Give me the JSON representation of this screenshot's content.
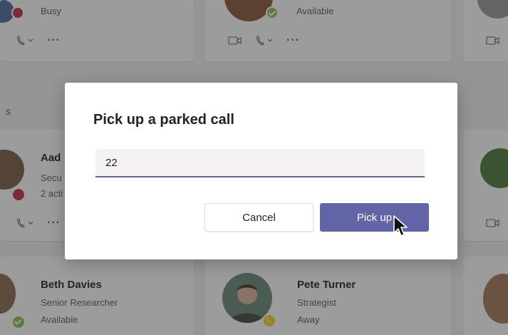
{
  "contacts": {
    "top_left": {
      "status": "Busy",
      "presence_color": "#c4314b"
    },
    "top_mid": {
      "status": "Available",
      "presence_color": "#92c353"
    },
    "mid_left": {
      "name": "Aad",
      "title": "Secu",
      "activity": "2 acti",
      "presence_color": "#c4314b"
    },
    "bottom_left": {
      "name": "Beth Davies",
      "title": "Senior Researcher",
      "status": "Available",
      "presence_color": "#92c353"
    },
    "bottom_mid": {
      "name": "Pete Turner",
      "title": "Strategist",
      "status": "Away",
      "presence_color": "#f8d22a"
    }
  },
  "section_fragment": "s",
  "more_label": "···",
  "dialog": {
    "title": "Pick up a parked call",
    "input_value": "22",
    "cancel_label": "Cancel",
    "pickup_label": "Pick up"
  },
  "colors": {
    "accent": "#6264a7",
    "overlay": "rgba(37,36,35,0.45)"
  }
}
